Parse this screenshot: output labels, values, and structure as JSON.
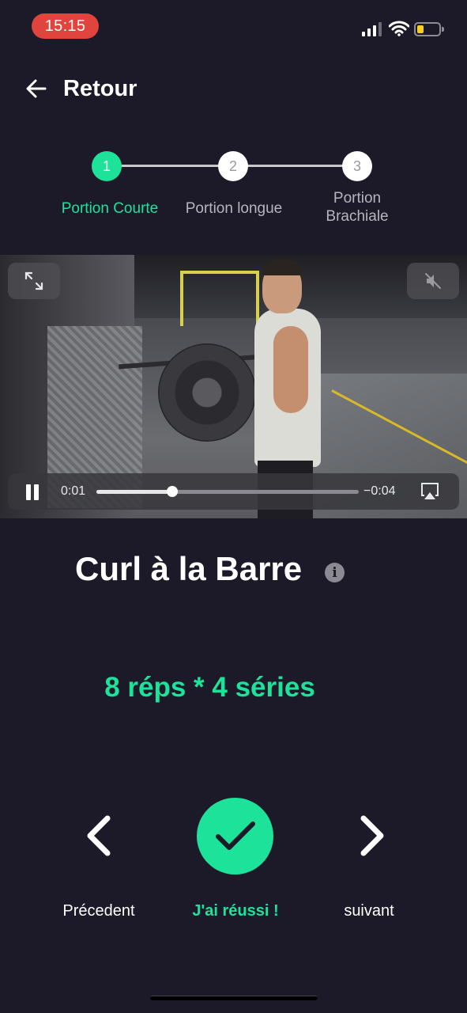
{
  "status_bar": {
    "time": "15:15",
    "icons": [
      "cellular-signal-icon",
      "wifi-icon",
      "battery-low-icon"
    ],
    "accent": "#e0443c"
  },
  "header": {
    "back_label": "Retour",
    "back_icon": "arrow-left-icon"
  },
  "stepper": {
    "active_index": 0,
    "steps": [
      {
        "number": "1",
        "label": "Portion Courte"
      },
      {
        "number": "2",
        "label": "Portion longue"
      },
      {
        "number": "3",
        "label": "Portion Brachiale"
      }
    ]
  },
  "video": {
    "elapsed": "0:01",
    "remaining": "−0:04",
    "progress": 0.29,
    "icons": [
      "fullscreen-icon",
      "mute-icon",
      "pause-icon",
      "airplay-icon"
    ]
  },
  "exercise": {
    "title": "Curl à la Barre",
    "reps": "8 réps * 4 séries"
  },
  "actions": {
    "previous": "Précedent",
    "success": "J'ai réussi !",
    "next": "suivant"
  },
  "colors": {
    "background": "#1c1a28",
    "accent": "#1de39a",
    "text": "#ffffff",
    "muted": "#b6b5bd"
  }
}
